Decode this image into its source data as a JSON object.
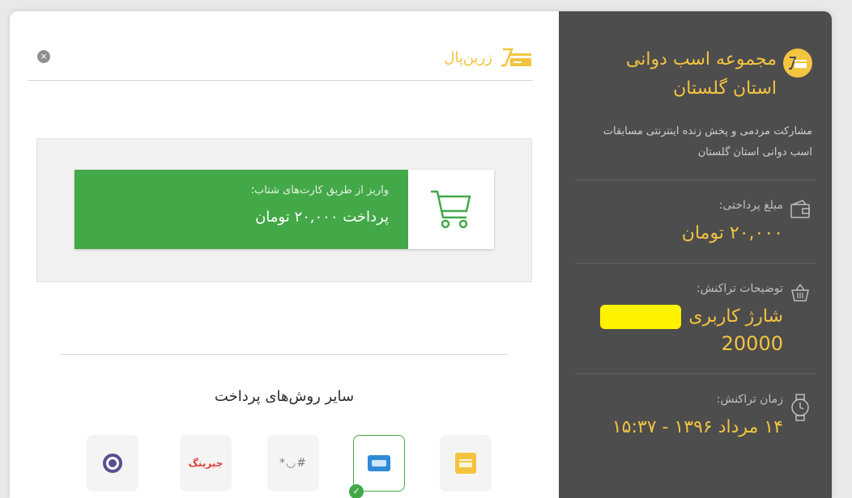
{
  "merchant": {
    "name": "مجموعه اسب دوانی استان گلستان",
    "description": "مشارکت مردمی و پخش زنده اینترنتی مسابقات اسب دوانی استان گلستان"
  },
  "amount": {
    "label": "مبلغ پرداختی:",
    "value": "۲۰,۰۰۰ تومان"
  },
  "transaction": {
    "label": "توضیحات تراکنش:",
    "value_line1": "شارژ کاربری",
    "value_line2": "20000"
  },
  "time": {
    "label": "زمان تراکنش:",
    "value": "۱۴ مرداد ۱۳۹۶ - ۱۵:۳۷"
  },
  "header": {
    "brand": "زرین‌پال",
    "close_icon": "×"
  },
  "shetab": {
    "subtitle": "واریز از طریق کارت‌های شتاب؛",
    "action": "پرداخت ۲۰,۰۰۰ تومان"
  },
  "other_methods": {
    "title": "سایر روش‌های پرداخت",
    "items": [
      {
        "name": "zarin-card",
        "icon": "zarinpal-card-icon"
      },
      {
        "name": "card",
        "icon": "card-icon",
        "selected": true
      },
      {
        "name": "ussd",
        "icon": "ussd-icon",
        "text": "*◡#"
      },
      {
        "name": "jiring",
        "icon": "jiring-logo",
        "text": "جیرینگ"
      },
      {
        "name": "bank",
        "icon": "bank-seal-icon"
      }
    ]
  },
  "colors": {
    "accent": "#f3c43f",
    "panel": "#4d4d4d",
    "green": "#43a847"
  }
}
